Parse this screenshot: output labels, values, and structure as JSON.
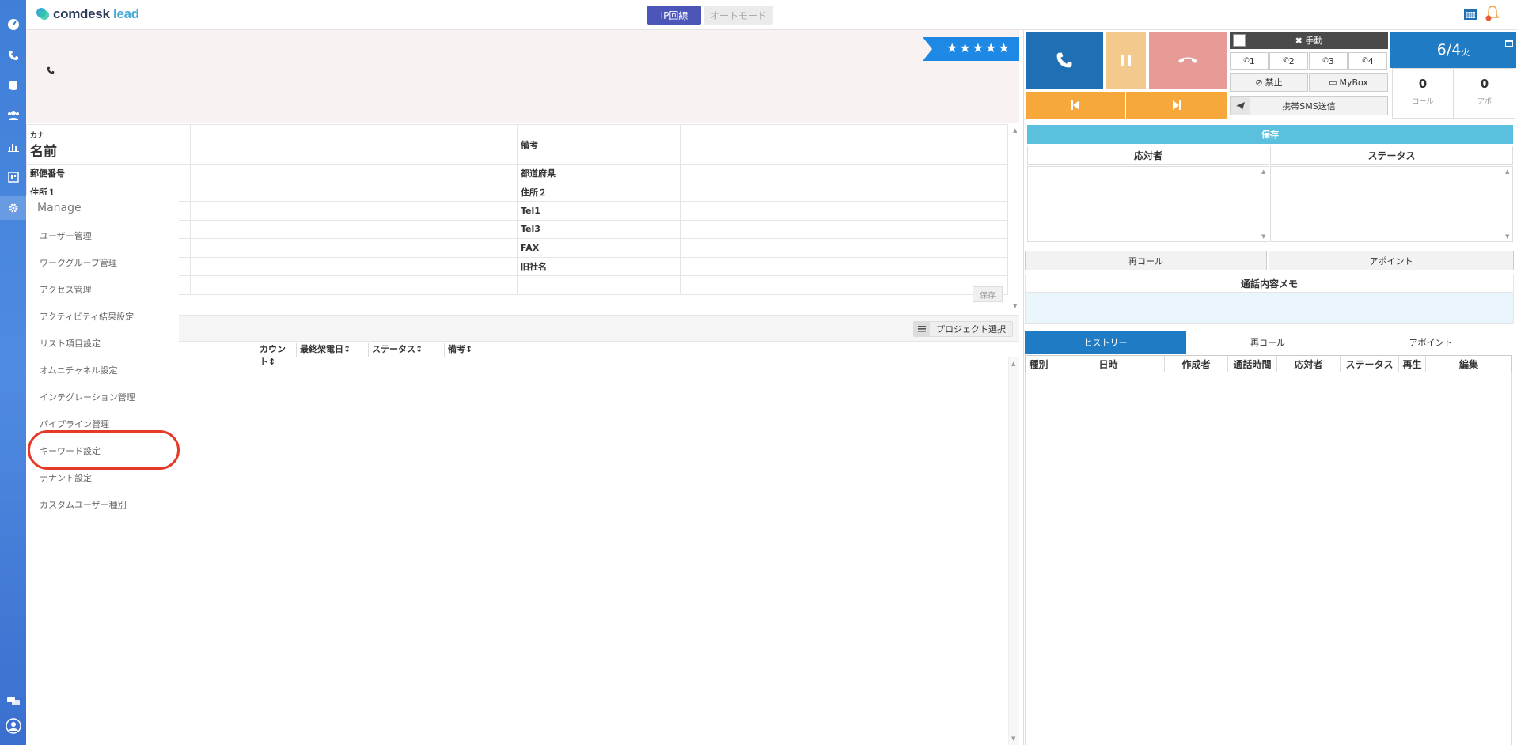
{
  "brand": {
    "name_main": "comdesk",
    "name_accent": "lead"
  },
  "topbar": {
    "ip_line": "IP回線",
    "auto_mode": "オートモード"
  },
  "rating": {
    "stars": "★★★★★"
  },
  "form": {
    "kana_label": "カナ",
    "name_label": "名前",
    "rows": [
      {
        "l1": "郵便番号",
        "l2": "都道府県"
      },
      {
        "l1": "住所１",
        "l2": "住所２"
      },
      {
        "l1": "",
        "l2": "Tel1"
      },
      {
        "l1": "",
        "l2": "Tel3"
      },
      {
        "l1": "",
        "l2": "FAX"
      },
      {
        "l1": "",
        "l2": "旧社名"
      }
    ],
    "remarks_label": "備考",
    "save_label": "保存"
  },
  "project": {
    "select_label": "プロジェクト選択"
  },
  "list_columns": [
    "カウント↕",
    "最終架電日↕",
    "ステータス↕",
    "備考↕"
  ],
  "manage": {
    "title": "Manage",
    "items": [
      "ユーザー管理",
      "ワークグループ管理",
      "アクセス管理",
      "アクティビティ結果設定",
      "リスト項目設定",
      "オムニチャネル設定",
      "インテグレーション管理",
      "パイプライン管理",
      "キーワード設定",
      "テナント設定",
      "カスタムユーザー種別"
    ]
  },
  "right": {
    "manual": "✖ 手動",
    "lines": [
      "1",
      "2",
      "3",
      "4"
    ],
    "block": "禁止",
    "mybox": "MyBox",
    "sms": "携帯SMS送信",
    "date": "6/4",
    "dow": "火",
    "calls_count": "0",
    "calls_label": "コール",
    "appo_count": "0",
    "appo_label": "アポ",
    "save": "保存",
    "responder": "応対者",
    "status": "ステータス",
    "recall": "再コール",
    "appoint": "アポイント",
    "memo": "通話内容メモ",
    "tabs": [
      "ヒストリー",
      "再コール",
      "アポイント"
    ],
    "history_cols": [
      "種別",
      "日時",
      "作成者",
      "通話時間",
      "応対者",
      "ステータス",
      "再生",
      "編集"
    ]
  },
  "colors": {
    "accent": "#1f6fb5",
    "rail": "#4a86dd",
    "highlight": "#e53a2a"
  }
}
